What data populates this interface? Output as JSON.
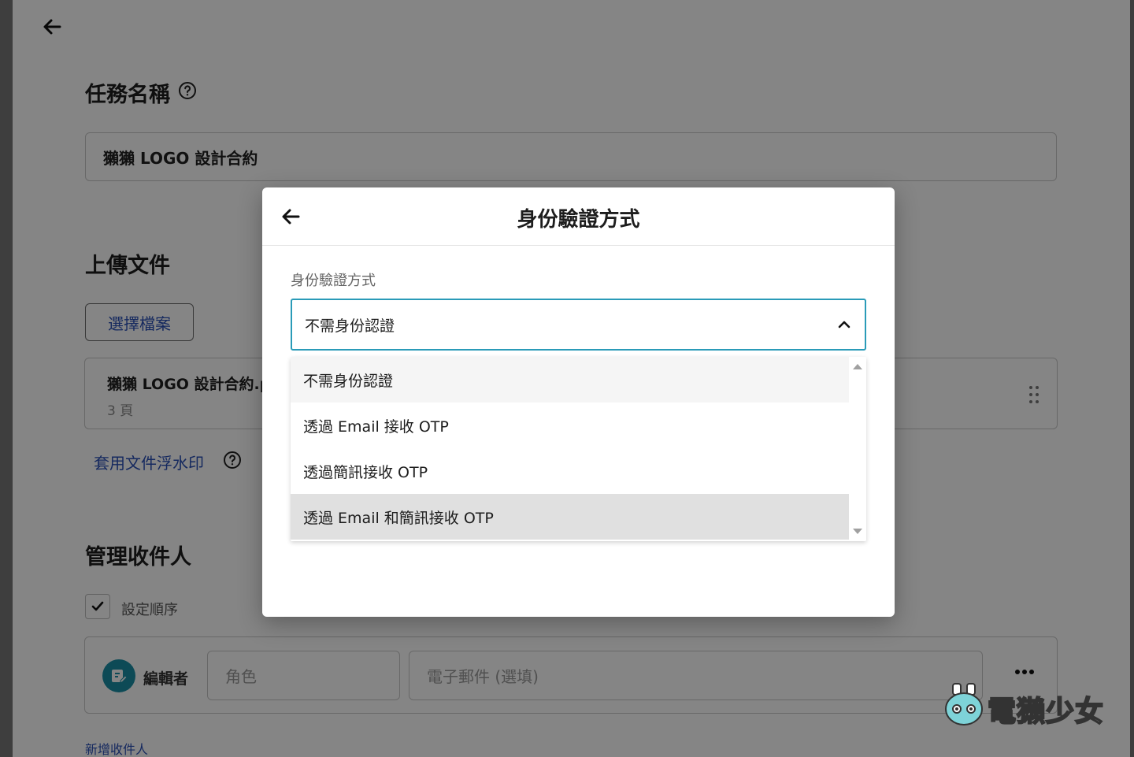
{
  "page": {
    "task_name_title": "任務名稱",
    "task_name_value": "獺獺 LOGO 設計合約",
    "upload_title": "上傳文件",
    "choose_file_button": "選擇檔案",
    "file": {
      "name": "獺獺 LOGO 設計合約.p",
      "pages": "3 頁"
    },
    "watermark_link": "套用文件浮水印",
    "recipients_title": "管理收件人",
    "set_order_label": "設定順序",
    "recipient": {
      "role_label": "編輯者",
      "role_placeholder": "角色",
      "email_placeholder": "電子郵件 (選填)"
    },
    "add_recipient_link": "新增收件人"
  },
  "modal": {
    "title": "身份驗證方式",
    "field_label": "身份驗證方式",
    "selected_value": "不需身份認證",
    "options": [
      {
        "label": "不需身份認證"
      },
      {
        "label": "透過 Email 接收 OTP"
      },
      {
        "label": "透過簡訊接收 OTP"
      },
      {
        "label": "透過 Email 和簡訊接收 OTP"
      }
    ]
  },
  "watermark": {
    "text": "電獺少女"
  },
  "colors": {
    "accent": "#2a9bb8",
    "link": "#2a4fb6",
    "avatar": "#1a8fa6"
  }
}
